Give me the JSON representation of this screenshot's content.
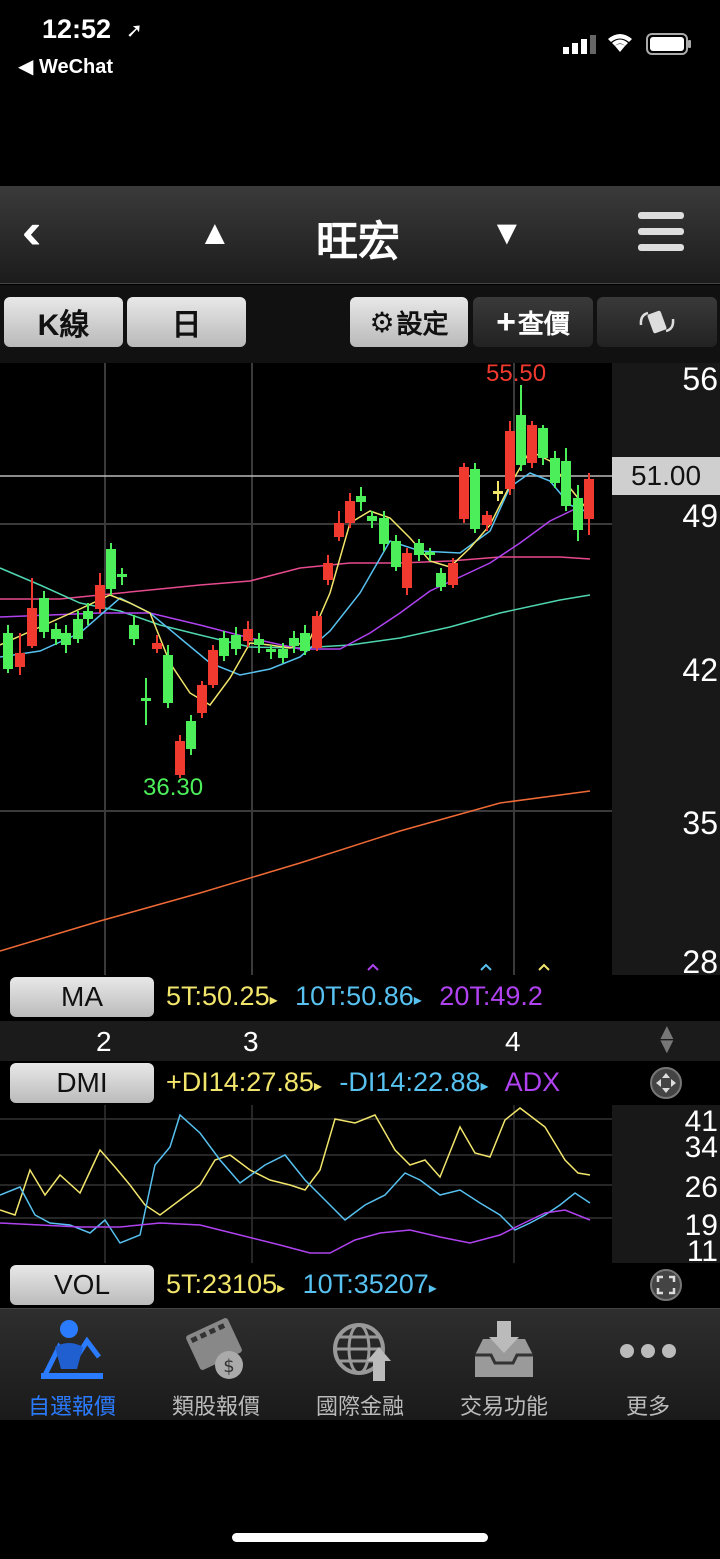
{
  "status_bar": {
    "time": "12:52",
    "back_app": "◀ WeChat"
  },
  "nav": {
    "title": "旺宏"
  },
  "toolbar": {
    "kline_label": "K線",
    "period_label": "日",
    "settings_label": "設定",
    "query_label": "查價"
  },
  "main_chart": {
    "y_ticks": [
      "56",
      "49",
      "42",
      "35",
      "28"
    ],
    "current_price": "51.00",
    "high_label": "55.50",
    "low_label": "36.30",
    "colors": {
      "up": "#f03a2f",
      "down": "#4cef5a",
      "ma5": "#f2e56b",
      "ma10": "#57c1f0",
      "ma20": "#b042f0",
      "ma60": "#4fd5b0",
      "ma120": "#e74a8e",
      "ma240": "#ef6a36"
    }
  },
  "ma_row": {
    "label": "MA",
    "values": [
      "5T:50.25",
      "10T:50.86",
      "20T:49.2"
    ]
  },
  "x_axis": {
    "labels": [
      "2",
      "3",
      "4"
    ]
  },
  "dmi_row": {
    "label": "DMI",
    "values": [
      "+DI14:27.85",
      "-DI14:22.88",
      "ADX"
    ]
  },
  "dmi_chart": {
    "y_ticks": [
      "41",
      "34",
      "26",
      "19",
      "11"
    ]
  },
  "vol_row": {
    "label": "VOL",
    "values": [
      "5T:23105",
      "10T:35207"
    ]
  },
  "tabs": [
    {
      "label": "自選報價",
      "icon": "person-chart-icon",
      "active": true
    },
    {
      "label": "類股報價",
      "icon": "film-coin-icon",
      "active": false
    },
    {
      "label": "國際金融",
      "icon": "globe-icon",
      "active": false
    },
    {
      "label": "交易功能",
      "icon": "inbox-download-icon",
      "active": false
    },
    {
      "label": "更多",
      "icon": "more-dots-icon",
      "active": false
    }
  ]
}
